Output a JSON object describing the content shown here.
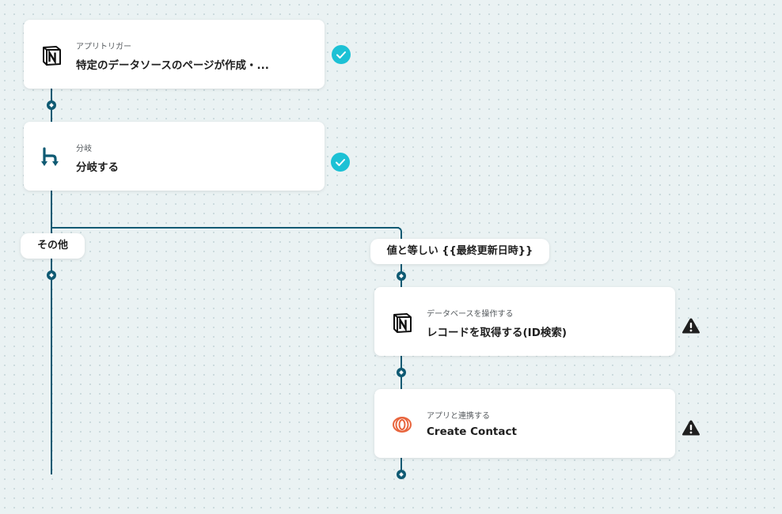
{
  "steps": [
    {
      "subtitle": "アプリトリガー",
      "title": "特定のデータソースのページが作成・...",
      "app_icon": "notion-icon",
      "status": "check-icon"
    },
    {
      "subtitle": "分岐",
      "title": "分岐する",
      "app_icon": "branch-icon",
      "status": "check-icon"
    },
    {
      "subtitle": "データベースを操作する",
      "title": "レコードを取得する(ID検索)",
      "app_icon": "notion-icon",
      "status": "warning-icon"
    },
    {
      "subtitle": "アプリと連携する",
      "title": "Create Contact",
      "app_icon": "loop-app-icon",
      "status": "warning-icon"
    }
  ],
  "branches": {
    "left_label": "その他",
    "right_label": "値と等しい {{最終更新日時}}"
  },
  "colors": {
    "connector": "#0f5a73",
    "check": "#1cc1d5",
    "warning": "#1f1f1f",
    "loop_app": "#e8643c"
  }
}
